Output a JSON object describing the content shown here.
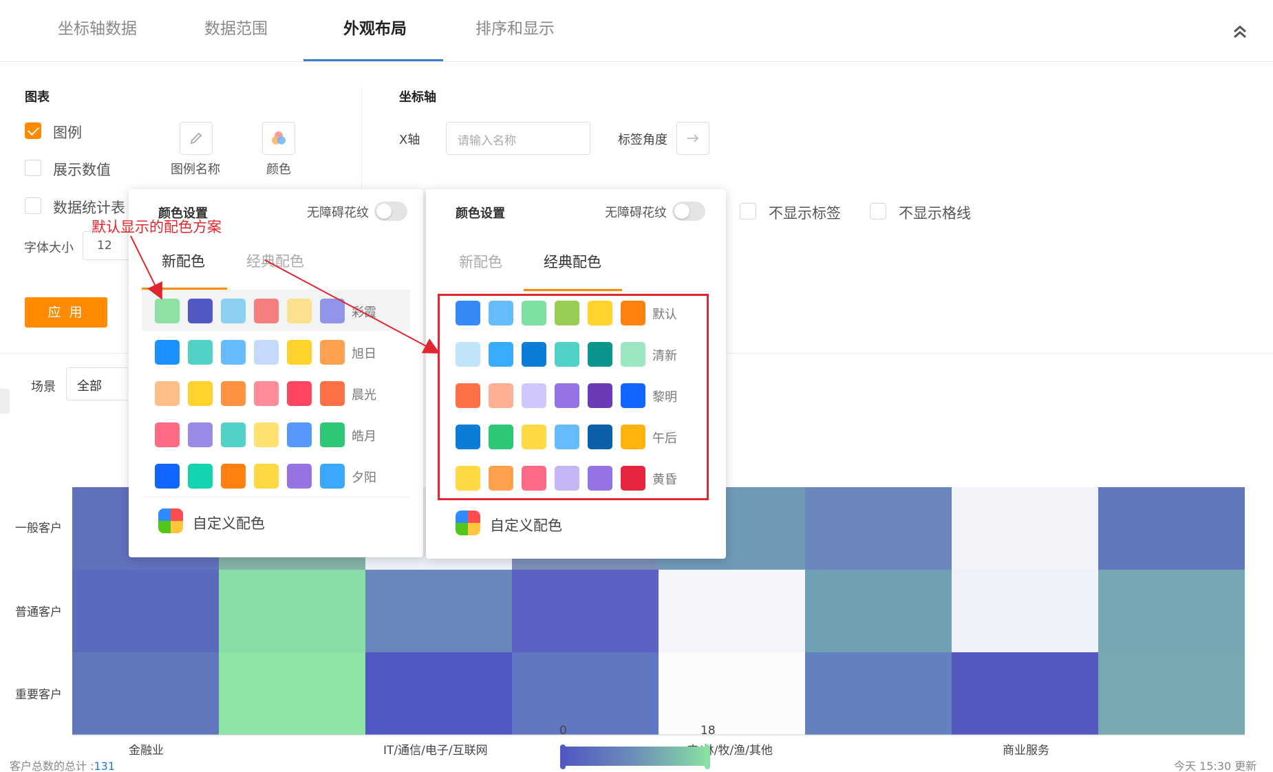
{
  "tabs": [
    {
      "label": "坐标轴数据"
    },
    {
      "label": "数据范围"
    },
    {
      "label": "外观布局",
      "active": true
    },
    {
      "label": "排序和显示"
    }
  ],
  "chart_section": {
    "title": "图表",
    "legend_checkbox": {
      "label": "图例",
      "checked": true
    },
    "show_values_checkbox": {
      "label": "展示数值",
      "checked": false
    },
    "data_stats_checkbox": {
      "label": "数据统计表",
      "checked": false
    },
    "legend_name_label": "图例名称",
    "color_label": "颜色",
    "font_size_label": "字体大小",
    "font_size_value": "12",
    "apply_button": "应 用"
  },
  "axis_section": {
    "title": "坐标轴",
    "x_axis_label": "X轴",
    "x_axis_placeholder": "请输入名称",
    "tag_angle_label": "标签角度",
    "hide_labels": "不显示标签",
    "hide_gridlines": "不显示格线"
  },
  "scene": {
    "label": "场景",
    "value": "全部"
  },
  "annotation": "默认显示的配色方案",
  "popover_left": {
    "title": "颜色设置",
    "accessibility_label": "无障碍花纹",
    "tabs": [
      "新配色",
      "经典配色"
    ],
    "active_tab": 0,
    "schemes": [
      {
        "name": "彩霞",
        "colors": [
          "#8ee0a3",
          "#5157c3",
          "#8dd1f2",
          "#f77e7e",
          "#fde08f",
          "#9195ea"
        ]
      },
      {
        "name": "旭日",
        "colors": [
          "#1b90ff",
          "#52d1c6",
          "#66bcfd",
          "#c4d9fc",
          "#ffd32b",
          "#ffa14f"
        ]
      },
      {
        "name": "晨光",
        "colors": [
          "#ffbd88",
          "#ffd32b",
          "#ff9240",
          "#ff8a99",
          "#ff4560",
          "#ff7047"
        ]
      },
      {
        "name": "皓月",
        "colors": [
          "#fe6a86",
          "#9b8ae8",
          "#52d1c6",
          "#ffe070",
          "#5698fb",
          "#2dc775"
        ]
      },
      {
        "name": "夕阳",
        "colors": [
          "#1166ff",
          "#14d4b0",
          "#ff7f0f",
          "#ffd944",
          "#9673e3",
          "#3ba8ff"
        ]
      }
    ],
    "custom_label": "自定义配色"
  },
  "popover_right": {
    "title": "颜色设置",
    "accessibility_label": "无障碍花纹",
    "tabs": [
      "新配色",
      "经典配色"
    ],
    "active_tab": 1,
    "schemes": [
      {
        "name": "默认",
        "colors": [
          "#3689f6",
          "#66bcfd",
          "#7be0a1",
          "#99cc55",
          "#ffd32b",
          "#ff7f0f"
        ]
      },
      {
        "name": "清新",
        "colors": [
          "#c0e4fc",
          "#3aacfe",
          "#0b7dd4",
          "#52d1c6",
          "#0c958d",
          "#9ae7c2"
        ]
      },
      {
        "name": "黎明",
        "colors": [
          "#ff7047",
          "#ffaf94",
          "#d1c6fc",
          "#9673e3",
          "#6b3bb5",
          "#1166ff"
        ]
      },
      {
        "name": "午后",
        "colors": [
          "#0b7dd4",
          "#2dc775",
          "#ffd944",
          "#66bcfd",
          "#0960a8",
          "#ffb30f"
        ]
      },
      {
        "name": "黄昏",
        "colors": [
          "#ffd944",
          "#ffa14f",
          "#fe6a86",
          "#c4b6f5",
          "#9673e3",
          "#e6263f"
        ]
      }
    ],
    "custom_label": "自定义配色"
  },
  "heatmap": {
    "row_labels": [
      "一般客户",
      "普通客户",
      "重要客户"
    ],
    "col_labels": [
      "金融业",
      "IT/通信/电子/互联网",
      "农/林/牧/渔/其他",
      "商业服务"
    ],
    "cells": [
      [
        "#6070bb",
        "#84b2a6",
        "#eef0f8",
        "#7d8fb8",
        "#6f99b6",
        "#6a86bd",
        "#f3f4fa",
        "#6277be"
      ],
      [
        "#5a6abd",
        "#89dda8",
        "#6a87bb",
        "#5b62c4",
        "#f5f6fb",
        "#70a0b4",
        "#eef1f9",
        "#75a8b2"
      ],
      [
        "#6078bb",
        "#8ee4a6",
        "#5157c3",
        "#6277c1",
        "#fbfbfb",
        "#6381bf",
        "#5459c2",
        "#76aab0"
      ]
    ],
    "legend_min": "0",
    "legend_max": "18",
    "total_label": "客户总数的总计 :",
    "total_value": "131",
    "updated": "今天 15:30 更新"
  }
}
